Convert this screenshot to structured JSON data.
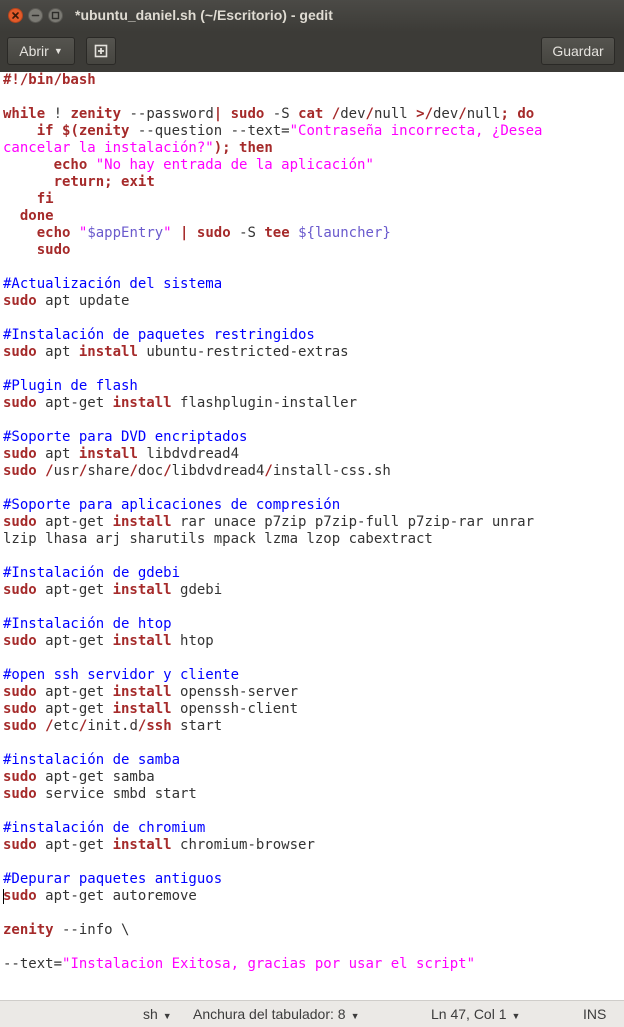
{
  "window": {
    "title": "*ubuntu_daniel.sh (~/Escritorio) - gedit"
  },
  "toolbar": {
    "open_label": "Abrir",
    "new_doc_icon": "new-document-icon",
    "save_label": "Guardar"
  },
  "editor": {
    "lines": [
      [
        [
          "#!/bin/bash",
          "kw"
        ]
      ],
      [],
      [
        [
          "while",
          "kw"
        ],
        [
          " ! "
        ],
        [
          "zenity",
          "kw"
        ],
        [
          " --password"
        ],
        [
          "|",
          "kw"
        ],
        [
          " "
        ],
        [
          "sudo",
          "kw"
        ],
        [
          " -S "
        ],
        [
          "cat",
          "kw"
        ],
        [
          " "
        ],
        [
          "/",
          "kw"
        ],
        [
          "dev"
        ],
        [
          "/",
          "kw"
        ],
        [
          "null "
        ],
        [
          ">",
          "kw"
        ],
        [
          "/",
          "kw"
        ],
        [
          "dev"
        ],
        [
          "/",
          "kw"
        ],
        [
          "null"
        ],
        [
          ";",
          "kw"
        ],
        [
          " "
        ],
        [
          "do",
          "kw"
        ]
      ],
      [
        [
          "    "
        ],
        [
          "if",
          "kw"
        ],
        [
          " "
        ],
        [
          "$(",
          "kw"
        ],
        [
          "zenity",
          "kw"
        ],
        [
          " --question --text="
        ],
        [
          "\"Contraseña incorrecta, ¿Desea",
          "st"
        ]
      ],
      [
        [
          "cancelar la instalación?\"",
          "st"
        ],
        [
          ")",
          "kw"
        ],
        [
          ";",
          "kw"
        ],
        [
          " "
        ],
        [
          "then",
          "kw"
        ]
      ],
      [
        [
          "      "
        ],
        [
          "echo",
          "kw"
        ],
        [
          " "
        ],
        [
          "\"No hay entrada de la aplicación\"",
          "st"
        ]
      ],
      [
        [
          "      "
        ],
        [
          "return",
          "kw"
        ],
        [
          ";",
          "kw"
        ],
        [
          " "
        ],
        [
          "exit",
          "kw"
        ]
      ],
      [
        [
          "    "
        ],
        [
          "fi",
          "kw"
        ]
      ],
      [
        [
          "  "
        ],
        [
          "done",
          "kw"
        ]
      ],
      [
        [
          "    "
        ],
        [
          "echo",
          "kw"
        ],
        [
          " "
        ],
        [
          "\"",
          "st"
        ],
        [
          "$appEntry",
          "vr"
        ],
        [
          "\"",
          "st"
        ],
        [
          " "
        ],
        [
          "|",
          "kw"
        ],
        [
          " "
        ],
        [
          "sudo",
          "kw"
        ],
        [
          " -S "
        ],
        [
          "tee",
          "kw"
        ],
        [
          " "
        ],
        [
          "${launcher}",
          "vr"
        ]
      ],
      [
        [
          "    "
        ],
        [
          "sudo",
          "kw"
        ]
      ],
      [],
      [
        [
          "#Actualización del sistema",
          "cm"
        ]
      ],
      [
        [
          "sudo",
          "kw"
        ],
        [
          " apt update"
        ]
      ],
      [],
      [
        [
          "#Instalación de paquetes restringidos",
          "cm"
        ]
      ],
      [
        [
          "sudo",
          "kw"
        ],
        [
          " apt "
        ],
        [
          "install",
          "kw"
        ],
        [
          " ubuntu-restricted-extras"
        ]
      ],
      [],
      [
        [
          "#Plugin de flash",
          "cm"
        ]
      ],
      [
        [
          "sudo",
          "kw"
        ],
        [
          " apt-get "
        ],
        [
          "install",
          "kw"
        ],
        [
          " flashplugin-installer"
        ]
      ],
      [],
      [
        [
          "#Soporte para DVD encriptados",
          "cm"
        ]
      ],
      [
        [
          "sudo",
          "kw"
        ],
        [
          " apt "
        ],
        [
          "install",
          "kw"
        ],
        [
          " libdvdread4"
        ]
      ],
      [
        [
          "sudo",
          "kw"
        ],
        [
          " "
        ],
        [
          "/",
          "kw"
        ],
        [
          "usr"
        ],
        [
          "/",
          "kw"
        ],
        [
          "share"
        ],
        [
          "/",
          "kw"
        ],
        [
          "doc"
        ],
        [
          "/",
          "kw"
        ],
        [
          "libdvdread4"
        ],
        [
          "/",
          "kw"
        ],
        [
          "install-css.sh"
        ]
      ],
      [],
      [
        [
          "#Soporte para aplicaciones de compresión",
          "cm"
        ]
      ],
      [
        [
          "sudo",
          "kw"
        ],
        [
          " apt-get "
        ],
        [
          "install",
          "kw"
        ],
        [
          " rar unace p7zip p7zip-full p7zip-rar unrar"
        ]
      ],
      [
        [
          "lzip lhasa arj sharutils mpack lzma lzop cabextract"
        ]
      ],
      [],
      [
        [
          "#Instalación de gdebi",
          "cm"
        ]
      ],
      [
        [
          "sudo",
          "kw"
        ],
        [
          " apt-get "
        ],
        [
          "install",
          "kw"
        ],
        [
          " gdebi"
        ]
      ],
      [],
      [
        [
          "#Instalación de htop",
          "cm"
        ]
      ],
      [
        [
          "sudo",
          "kw"
        ],
        [
          " apt-get "
        ],
        [
          "install",
          "kw"
        ],
        [
          " htop"
        ]
      ],
      [],
      [
        [
          "#open ssh servidor y cliente",
          "cm"
        ]
      ],
      [
        [
          "sudo",
          "kw"
        ],
        [
          " apt-get "
        ],
        [
          "install",
          "kw"
        ],
        [
          " openssh-server"
        ]
      ],
      [
        [
          "sudo",
          "kw"
        ],
        [
          " apt-get "
        ],
        [
          "install",
          "kw"
        ],
        [
          " openssh-client"
        ]
      ],
      [
        [
          "sudo",
          "kw"
        ],
        [
          " "
        ],
        [
          "/",
          "kw"
        ],
        [
          "etc"
        ],
        [
          "/",
          "kw"
        ],
        [
          "init.d"
        ],
        [
          "/",
          "kw"
        ],
        [
          "ssh",
          "kw"
        ],
        [
          " start"
        ]
      ],
      [],
      [
        [
          "#instalación de samba",
          "cm"
        ]
      ],
      [
        [
          "sudo",
          "kw"
        ],
        [
          " apt-get samba"
        ]
      ],
      [
        [
          "sudo",
          "kw"
        ],
        [
          " service smbd start"
        ]
      ],
      [],
      [
        [
          "#instalación de chromium",
          "cm"
        ]
      ],
      [
        [
          "sudo",
          "kw"
        ],
        [
          " apt-get "
        ],
        [
          "install",
          "kw"
        ],
        [
          " chromium-browser"
        ]
      ],
      [],
      [
        [
          "#Depurar paquetes antiguos",
          "cm"
        ]
      ],
      [
        [
          "sudo",
          "kw",
          "cursor"
        ],
        [
          " apt-get autoremove"
        ]
      ],
      [],
      [
        [
          "zenity",
          "kw"
        ],
        [
          " --info \\"
        ]
      ],
      [],
      [
        [
          "--text="
        ],
        [
          "\"Instalacion Exitosa, gracias por usar el script\"",
          "st"
        ]
      ]
    ]
  },
  "statusbar": {
    "language": "sh",
    "tab_width": "Anchura del tabulador: 8",
    "position": "Ln 47, Col 1",
    "mode": "INS"
  },
  "colors": {
    "keyword": "#a52a2a",
    "string": "#ff00ff",
    "comment": "#0000ff",
    "variable": "#6a5acd"
  }
}
